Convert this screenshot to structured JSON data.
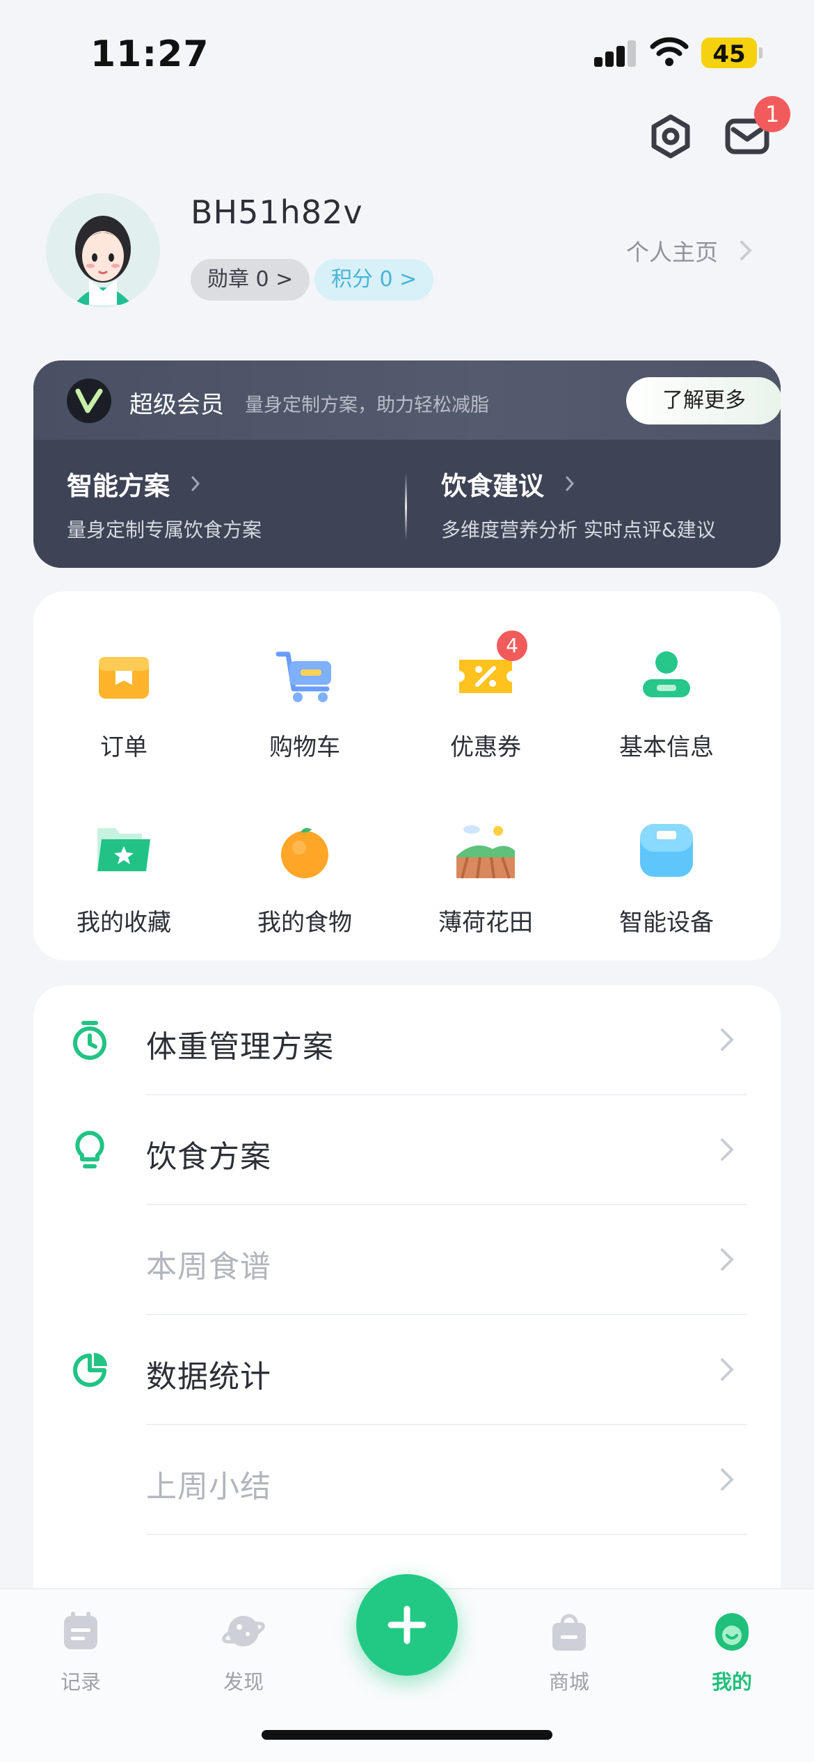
{
  "status_bar": {
    "time": "11:27",
    "battery": "45"
  },
  "header": {
    "mail_badge": "1"
  },
  "profile": {
    "username": "BH51h82v",
    "medal_chip": "勋章 0 >",
    "points_chip": "积分 0 >",
    "home_link": "个人主页"
  },
  "vip": {
    "title": "超级会员",
    "subtitle": "量身定制方案，助力轻松减脂",
    "button": "了解更多",
    "columns": [
      {
        "title": "智能方案",
        "desc": "量身定制专属饮食方案"
      },
      {
        "title": "饮食建议",
        "desc": "多维度营养分析 实时点评&建议"
      }
    ]
  },
  "grid": {
    "items": [
      {
        "label": "订单",
        "icon": "order-box-icon"
      },
      {
        "label": "购物车",
        "icon": "cart-icon"
      },
      {
        "label": "优惠券",
        "icon": "coupon-icon",
        "badge": "4"
      },
      {
        "label": "基本信息",
        "icon": "profile-info-icon"
      },
      {
        "label": "我的收藏",
        "icon": "favorites-folder-icon"
      },
      {
        "label": "我的食物",
        "icon": "orange-icon"
      },
      {
        "label": "薄荷花田",
        "icon": "farm-field-icon"
      },
      {
        "label": "智能设备",
        "icon": "smart-scale-icon"
      }
    ]
  },
  "menu": {
    "rows": [
      {
        "label": "体重管理方案",
        "icon": "timer-icon"
      },
      {
        "label": "饮食方案",
        "icon": "lightbulb-icon"
      },
      {
        "label": "本周食谱"
      },
      {
        "label": "数据统计",
        "icon": "pie-chart-icon"
      },
      {
        "label": "上周小结"
      }
    ]
  },
  "tabbar": {
    "tabs": [
      {
        "label": "记录",
        "icon": "record-icon"
      },
      {
        "label": "发现",
        "icon": "planet-icon"
      },
      {
        "label": "商城",
        "icon": "shopping-bag-icon"
      },
      {
        "label": "我的",
        "icon": "me-icon",
        "active": true
      }
    ]
  },
  "colors": {
    "accent": "#20c07a",
    "badge": "#f25b5b",
    "vip_bg": "#3e4355"
  }
}
